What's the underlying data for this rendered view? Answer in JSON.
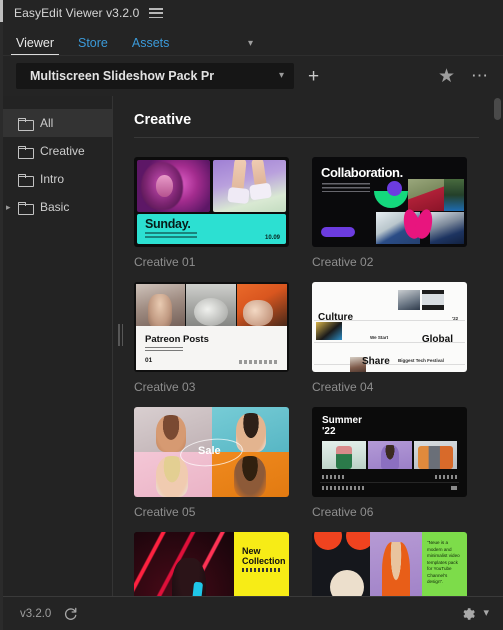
{
  "window": {
    "title": "EasyEdit Viewer v3.2.0",
    "menu_icon": "hamburger-icon"
  },
  "tabs": {
    "items": [
      {
        "label": "Viewer",
        "active": true
      },
      {
        "label": "Store",
        "active": false
      },
      {
        "label": "Assets",
        "active": false
      }
    ],
    "overflow_icon": "chevron-down-icon"
  },
  "toolbar": {
    "preset_value": "Multiscreen Slideshow Pack Pr",
    "preset_chevron": "chevron-down-icon",
    "add_label": "+",
    "favorite_icon": "star-icon",
    "more_icon": "ellipsis-icon"
  },
  "sidebar": {
    "items": [
      {
        "label": "All",
        "selected": true,
        "expandable": false
      },
      {
        "label": "Creative",
        "selected": false,
        "expandable": false
      },
      {
        "label": "Intro",
        "selected": false,
        "expandable": false
      },
      {
        "label": "Basic",
        "selected": false,
        "expandable": true
      }
    ]
  },
  "content": {
    "section_title": "Creative",
    "cards": [
      {
        "label": "Creative 01",
        "art": "c1",
        "art_text": {
          "headline": "Sunday.",
          "time": "10.09"
        }
      },
      {
        "label": "Creative 02",
        "art": "c2",
        "art_text": {
          "headline": "Collaboration."
        }
      },
      {
        "label": "Creative 03",
        "art": "c3",
        "art_text": {
          "headline": "Patreon Posts",
          "number": "01"
        }
      },
      {
        "label": "Creative 04",
        "art": "c4",
        "art_text": {
          "w1": "Culture",
          "w2": "Global",
          "w3": "Share",
          "tiny1": "We Start",
          "tiny2": "Biggest Tech Festival",
          "tiny3": "'22"
        }
      },
      {
        "label": "Creative 05",
        "art": "c5",
        "art_text": {
          "headline": "Sale"
        }
      },
      {
        "label": "Creative 06",
        "art": "c6",
        "art_text": {
          "headline": "Summer",
          "year": "'22"
        }
      },
      {
        "label": "",
        "art": "c7",
        "art_text": {
          "headline": "New\nCollection",
          "sub": "Spring - Summer '22"
        }
      },
      {
        "label": "",
        "art": "c8",
        "art_text": {
          "quote": "\"Neue is a modern and minimalist video templates pack for YouTube Channel's design\"."
        }
      }
    ]
  },
  "statusbar": {
    "version": "v3.2.0",
    "refresh_icon": "refresh-icon",
    "settings_icon": "gear-icon",
    "settings_chevron": "chevron-down-icon"
  },
  "colors": {
    "app_bg": "#242424",
    "sidebar_bg": "#232323",
    "selected_row": "#333333",
    "link_blue": "#3b9ad9",
    "text_primary": "#e8e8e8",
    "text_muted": "#8e8e8e",
    "input_bg": "#161616"
  },
  "scrollbar": {
    "orientation": "vertical",
    "thumb_position_pct": 2
  }
}
